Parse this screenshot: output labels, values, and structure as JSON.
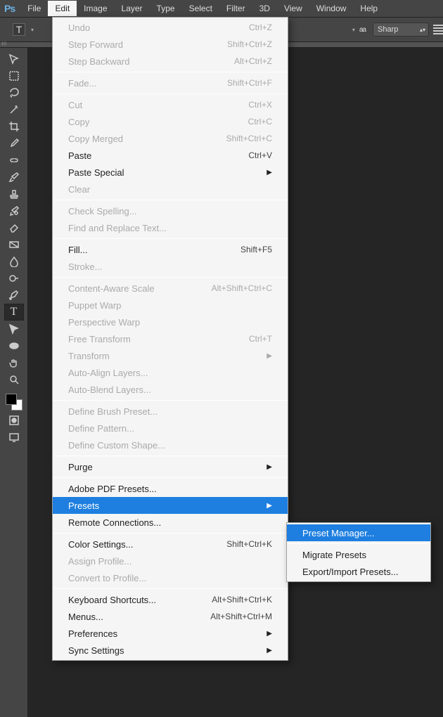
{
  "app_logo": "Ps",
  "menubar": {
    "items": [
      "File",
      "Edit",
      "Image",
      "Layer",
      "Type",
      "Select",
      "Filter",
      "3D",
      "View",
      "Window",
      "Help"
    ],
    "active": "Edit"
  },
  "options_bar": {
    "tool_letter": "T",
    "aa_label": "aa",
    "antialias_value": "Sharp"
  },
  "ruler_marks": "10",
  "tools": [
    "move",
    "marquee",
    "lasso",
    "wand",
    "crop",
    "eyedropper",
    "heal",
    "brush",
    "stamp",
    "history",
    "eraser",
    "gradient",
    "blur",
    "dodge",
    "pen",
    "type",
    "path",
    "ellipse",
    "hand",
    "zoom"
  ],
  "edit_menu": [
    {
      "label": "Undo",
      "shortcut": "Ctrl+Z",
      "disabled": true
    },
    {
      "label": "Step Forward",
      "shortcut": "Shift+Ctrl+Z",
      "disabled": true
    },
    {
      "label": "Step Backward",
      "shortcut": "Alt+Ctrl+Z",
      "disabled": true
    },
    {
      "sep": true
    },
    {
      "label": "Fade...",
      "shortcut": "Shift+Ctrl+F",
      "disabled": true
    },
    {
      "sep": true
    },
    {
      "label": "Cut",
      "shortcut": "Ctrl+X",
      "disabled": true
    },
    {
      "label": "Copy",
      "shortcut": "Ctrl+C",
      "disabled": true
    },
    {
      "label": "Copy Merged",
      "shortcut": "Shift+Ctrl+C",
      "disabled": true
    },
    {
      "label": "Paste",
      "shortcut": "Ctrl+V"
    },
    {
      "label": "Paste Special",
      "submenu": true
    },
    {
      "label": "Clear",
      "disabled": true
    },
    {
      "sep": true
    },
    {
      "label": "Check Spelling...",
      "disabled": true
    },
    {
      "label": "Find and Replace Text...",
      "disabled": true
    },
    {
      "sep": true
    },
    {
      "label": "Fill...",
      "shortcut": "Shift+F5"
    },
    {
      "label": "Stroke...",
      "disabled": true
    },
    {
      "sep": true
    },
    {
      "label": "Content-Aware Scale",
      "shortcut": "Alt+Shift+Ctrl+C",
      "disabled": true
    },
    {
      "label": "Puppet Warp",
      "disabled": true
    },
    {
      "label": "Perspective Warp",
      "disabled": true
    },
    {
      "label": "Free Transform",
      "shortcut": "Ctrl+T",
      "disabled": true
    },
    {
      "label": "Transform",
      "submenu": true,
      "disabled": true
    },
    {
      "label": "Auto-Align Layers...",
      "disabled": true
    },
    {
      "label": "Auto-Blend Layers...",
      "disabled": true
    },
    {
      "sep": true
    },
    {
      "label": "Define Brush Preset...",
      "disabled": true
    },
    {
      "label": "Define Pattern...",
      "disabled": true
    },
    {
      "label": "Define Custom Shape...",
      "disabled": true
    },
    {
      "sep": true
    },
    {
      "label": "Purge",
      "submenu": true
    },
    {
      "sep": true
    },
    {
      "label": "Adobe PDF Presets..."
    },
    {
      "label": "Presets",
      "submenu": true,
      "highlight": true
    },
    {
      "label": "Remote Connections..."
    },
    {
      "sep": true
    },
    {
      "label": "Color Settings...",
      "shortcut": "Shift+Ctrl+K"
    },
    {
      "label": "Assign Profile...",
      "disabled": true
    },
    {
      "label": "Convert to Profile...",
      "disabled": true
    },
    {
      "sep": true
    },
    {
      "label": "Keyboard Shortcuts...",
      "shortcut": "Alt+Shift+Ctrl+K"
    },
    {
      "label": "Menus...",
      "shortcut": "Alt+Shift+Ctrl+M"
    },
    {
      "label": "Preferences",
      "submenu": true
    },
    {
      "label": "Sync Settings",
      "submenu": true
    }
  ],
  "presets_submenu": [
    {
      "label": "Preset Manager...",
      "highlight": true
    },
    {
      "sep": true
    },
    {
      "label": "Migrate Presets"
    },
    {
      "label": "Export/Import Presets..."
    }
  ]
}
